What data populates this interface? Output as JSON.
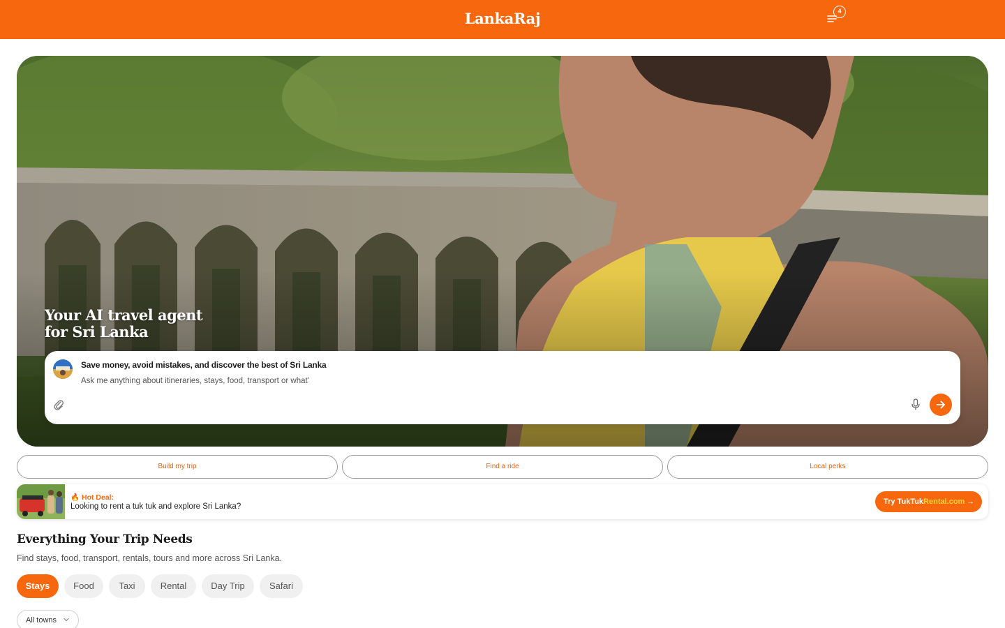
{
  "brand": {
    "name": "LankaRaj",
    "accent": "#f6670e"
  },
  "header": {
    "cart_icon": "list-cart-icon",
    "cart_count": "4"
  },
  "hero": {
    "title_line1": "Your AI travel agent",
    "title_line2": "for Sri Lanka",
    "chat": {
      "heading": "Save money, avoid mistakes, and discover the best of Sri Lanka",
      "placeholder": "Ask me anything about itineraries, stays, food, transport or what'"
    }
  },
  "quick_actions": [
    {
      "label": "Build my trip"
    },
    {
      "label": "Find a ride"
    },
    {
      "label": "Local perks"
    }
  ],
  "deal": {
    "tag": "🔥 Hot Deal:",
    "text": "Looking to rent a tuk tuk and explore Sri Lanka?",
    "cta_prefix": "Try TukTuk",
    "cta_accent": "Rental.com",
    "cta_arrow": "→"
  },
  "section": {
    "title": "Everything Your Trip Needs",
    "subtitle": "Find stays, food, transport, rentals, tours and more across Sri Lanka.",
    "categories": [
      {
        "label": "Stays",
        "active": true
      },
      {
        "label": "Food",
        "active": false
      },
      {
        "label": "Taxi",
        "active": false
      },
      {
        "label": "Rental",
        "active": false
      },
      {
        "label": "Day Trip",
        "active": false
      },
      {
        "label": "Safari",
        "active": false
      }
    ],
    "town_filter": "All towns"
  }
}
